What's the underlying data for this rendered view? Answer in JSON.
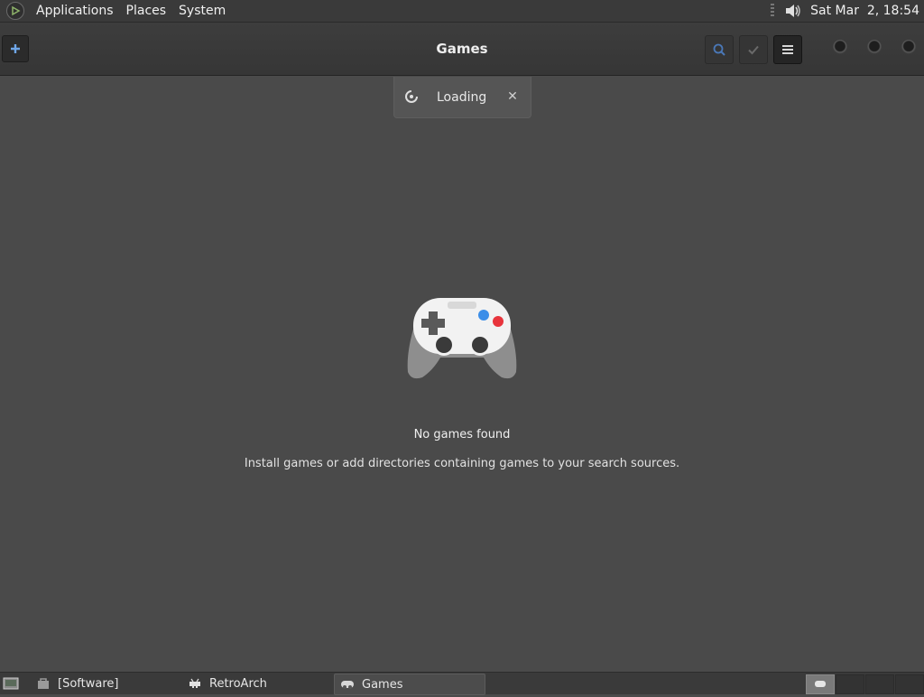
{
  "top_panel": {
    "menus": [
      "Applications",
      "Places",
      "System"
    ],
    "clock": "Sat Mar  2, 18:54"
  },
  "headerbar": {
    "title": "Games"
  },
  "notification": {
    "label": "Loading",
    "close_glyph": "✕"
  },
  "empty_state": {
    "icon": "gamepad-icon",
    "title": "No games found",
    "description": "Install games or add directories containing games to your search sources."
  },
  "taskbar": {
    "tasks": [
      {
        "label": "[Software]",
        "icon": "software-icon",
        "active": false
      },
      {
        "label": "RetroArch",
        "icon": "retroarch-icon",
        "active": false
      },
      {
        "label": "Games",
        "icon": "gamepad-small-icon",
        "active": true
      }
    ],
    "workspaces": [
      {
        "active": true
      },
      {
        "active": false
      },
      {
        "active": false
      },
      {
        "active": false
      }
    ]
  },
  "colors": {
    "background": "#4a4a4a",
    "panel": "#3a3a3a",
    "accent_blue": "#3c8ee8",
    "accent_red": "#e8343c"
  }
}
